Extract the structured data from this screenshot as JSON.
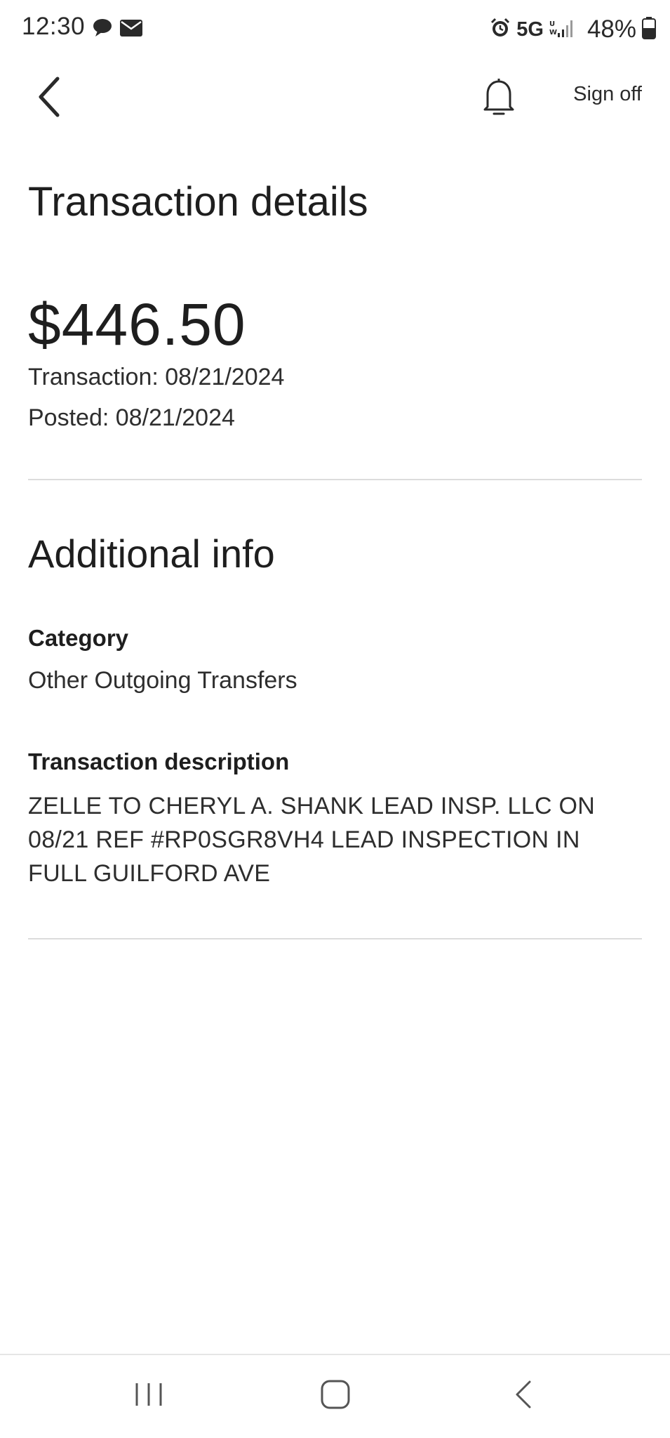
{
  "status_bar": {
    "time": "12:30",
    "network": "5G",
    "battery": "48%",
    "icons": [
      "chat-bubble-icon",
      "mail-icon",
      "alarm-icon",
      "signal-icon",
      "battery-icon"
    ]
  },
  "header": {
    "sign_off": "Sign off",
    "icons": [
      "back-chevron-icon",
      "bell-icon"
    ]
  },
  "transaction": {
    "title": "Transaction details",
    "amount": "$446.50",
    "transaction_date": "Transaction: 08/21/2024",
    "posted_date": "Posted: 08/21/2024"
  },
  "additional_info": {
    "title": "Additional info",
    "category_label": "Category",
    "category_value": "Other Outgoing Transfers",
    "description_label": "Transaction description",
    "description_value": "ZELLE TO CHERYL A. SHANK LEAD INSP. LLC ON 08/21 REF #RP0SGR8VH4 LEAD INSPECTION IN FULL GUILFORD AVE"
  },
  "nav_bar": {
    "buttons": [
      "recent-apps-icon",
      "home-icon",
      "back-icon"
    ]
  },
  "colors": {
    "text": "#1e1e1e",
    "divider": "#dcdcdc",
    "background": "#ffffff"
  }
}
